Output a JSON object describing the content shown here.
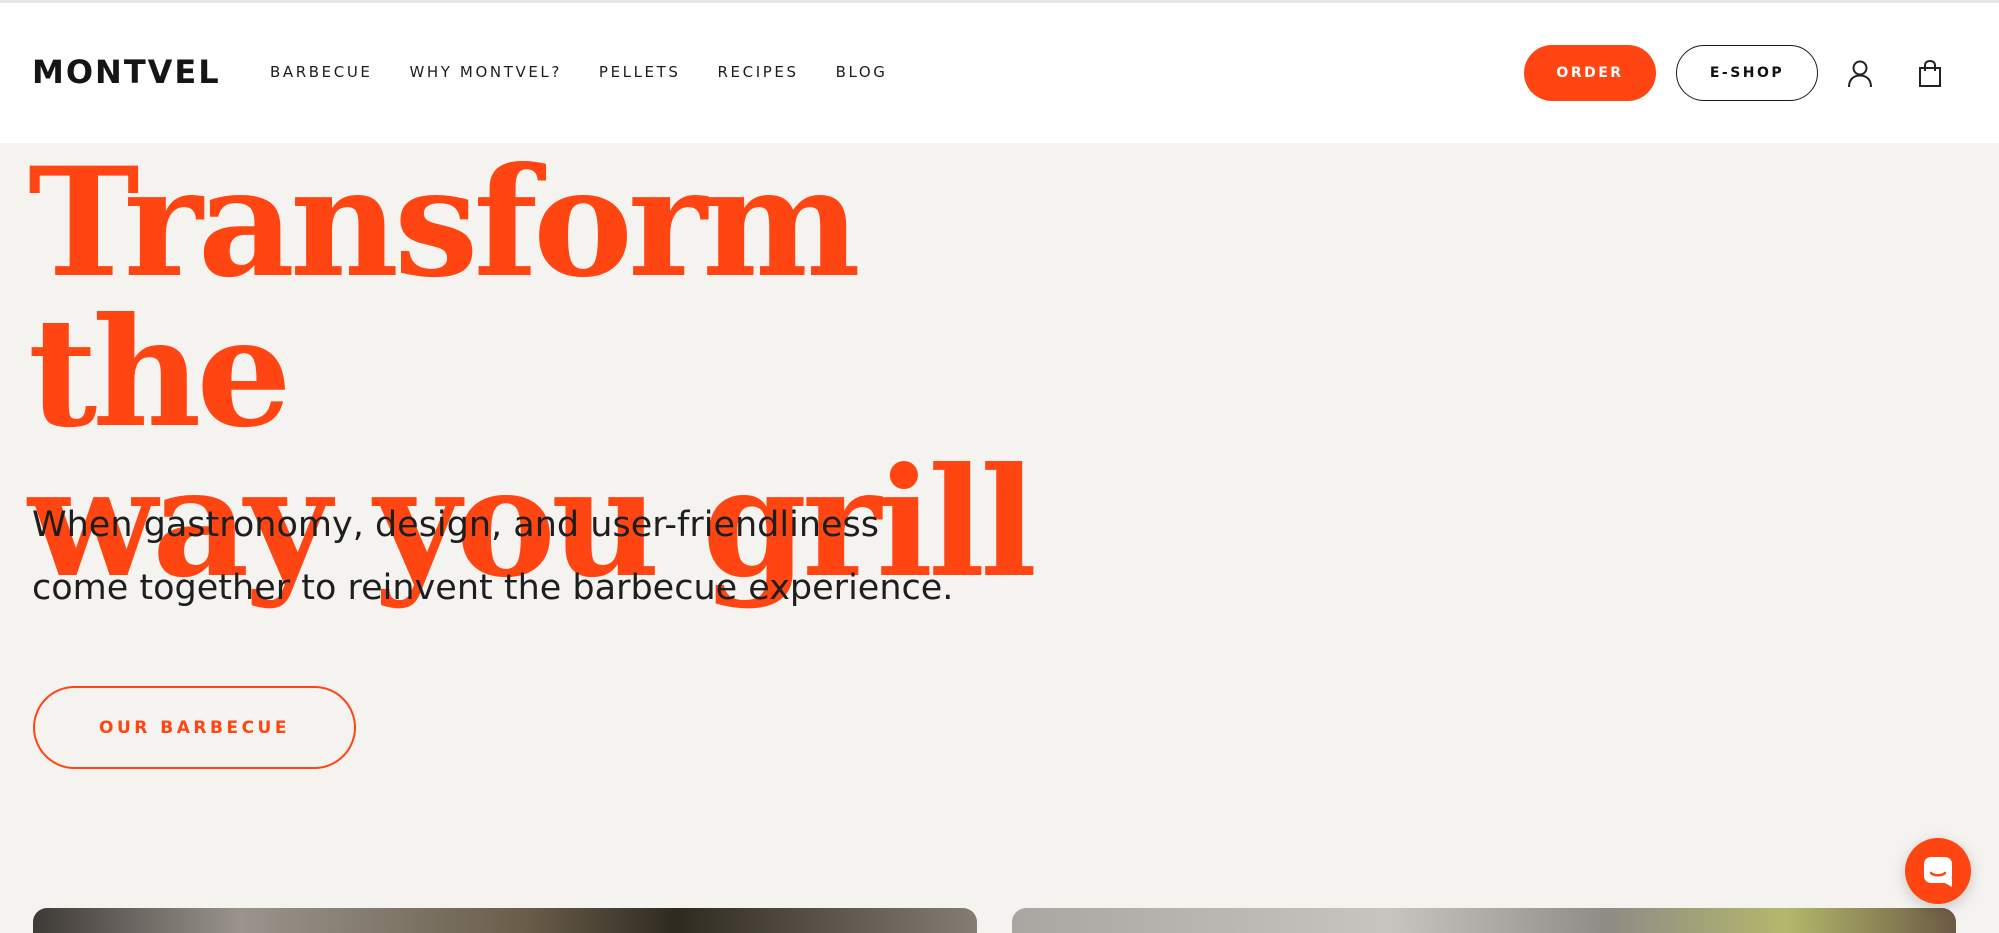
{
  "brand": {
    "name": "MONTVEL",
    "accent": "#ff4512"
  },
  "nav": {
    "items": [
      {
        "label": "BARBECUE"
      },
      {
        "label": "WHY MONTVEL?"
      },
      {
        "label": "PELLETS"
      },
      {
        "label": "RECIPES"
      },
      {
        "label": "BLOG"
      }
    ]
  },
  "header_actions": {
    "order_label": "ORDER",
    "eshop_label": "E-SHOP",
    "icons": [
      "user-icon",
      "shopping-bag-icon"
    ]
  },
  "hero": {
    "title_lines": [
      "Transform the",
      "way you grill"
    ],
    "subtitle_lines": [
      "When gastronomy, design, and user-friendliness",
      "come together to reinvent the barbecue experience."
    ],
    "cta_label": "OUR BARBECUE"
  },
  "chat": {
    "icon": "chat-icon"
  }
}
